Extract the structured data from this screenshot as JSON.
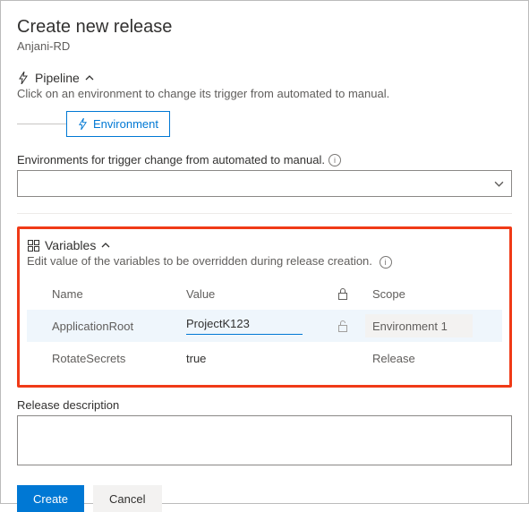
{
  "header": {
    "title": "Create new release",
    "subtitle": "Anjani-RD"
  },
  "pipeline": {
    "label": "Pipeline",
    "description": "Click on an environment to change its trigger from automated to manual.",
    "envBox": "Environment"
  },
  "envSelect": {
    "label": "Environments for trigger change from automated to manual."
  },
  "variables": {
    "label": "Variables",
    "description": "Edit value of the variables to be overridden during release creation.",
    "headers": {
      "name": "Name",
      "value": "Value",
      "scope": "Scope"
    },
    "rows": [
      {
        "name": "ApplicationRoot",
        "value": "ProjectK123",
        "scope": "Environment 1"
      },
      {
        "name": "RotateSecrets",
        "value": "true",
        "scope": "Release"
      }
    ]
  },
  "description": {
    "label": "Release description"
  },
  "actions": {
    "create": "Create",
    "cancel": "Cancel"
  }
}
